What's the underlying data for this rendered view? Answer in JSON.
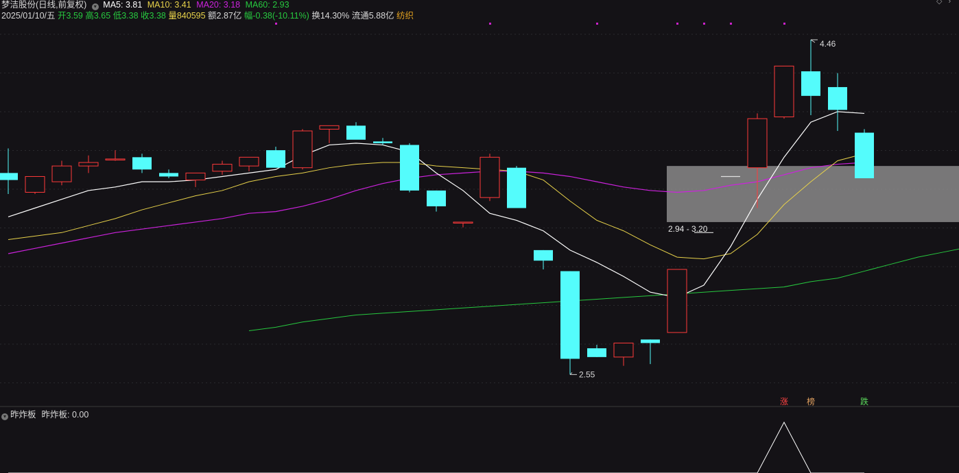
{
  "header": {
    "stock_name": "梦洁股份",
    "mode": "(日线,前复权)",
    "ma5_label": "MA5: 3.81",
    "ma10_label": "MA10: 3.41",
    "ma20_label": "MA20: 3.18",
    "ma60_label": "MA60: 2.93",
    "date": "2025/01/10/五",
    "open": "开3.59",
    "high": "高3.65",
    "low": "低3.38",
    "close": "收3.38",
    "volume": "量840595",
    "amount": "额2.87亿",
    "change": "幅-0.38(-10.11%)",
    "turnover": "换14.30%",
    "float_cap": "流通5.88亿",
    "industry": "纺织"
  },
  "sub_panel": {
    "name": "昨炸板",
    "value_label": "昨炸板: 0.00"
  },
  "colors": {
    "background": "#141216",
    "up": "#ff3a3a",
    "down": "#54fcfc",
    "ma5": "#ffffff",
    "ma10": "#e8d24a",
    "ma20": "#cc22dd",
    "ma60": "#27c93f",
    "zone": "#8a8a8a",
    "marker": "#cc22cc"
  },
  "chart_data": {
    "type": "candlestick",
    "y_range": [
      2.45,
      4.55
    ],
    "candles": [
      {
        "o": 3.7,
        "h": 3.84,
        "l": 3.58,
        "c": 3.66
      },
      {
        "o": 3.59,
        "h": 3.68,
        "l": 3.58,
        "c": 3.68
      },
      {
        "o": 3.65,
        "h": 3.77,
        "l": 3.63,
        "c": 3.74
      },
      {
        "o": 3.74,
        "h": 3.8,
        "l": 3.7,
        "c": 3.76
      },
      {
        "o": 3.78,
        "h": 3.83,
        "l": 3.77,
        "c": 3.78
      },
      {
        "o": 3.79,
        "h": 3.81,
        "l": 3.7,
        "c": 3.72
      },
      {
        "o": 3.7,
        "h": 3.72,
        "l": 3.67,
        "c": 3.68
      },
      {
        "o": 3.66,
        "h": 3.7,
        "l": 3.62,
        "c": 3.7
      },
      {
        "o": 3.71,
        "h": 3.77,
        "l": 3.69,
        "c": 3.75
      },
      {
        "o": 3.74,
        "h": 3.79,
        "l": 3.71,
        "c": 3.79
      },
      {
        "o": 3.83,
        "h": 3.85,
        "l": 3.73,
        "c": 3.73
      },
      {
        "o": 3.73,
        "h": 3.95,
        "l": 3.72,
        "c": 3.94
      },
      {
        "o": 3.95,
        "h": 3.97,
        "l": 3.87,
        "c": 3.97
      },
      {
        "o": 3.97,
        "h": 3.99,
        "l": 3.9,
        "c": 3.89
      },
      {
        "o": 3.88,
        "h": 3.9,
        "l": 3.86,
        "c": 3.87
      },
      {
        "o": 3.86,
        "h": 3.87,
        "l": 3.59,
        "c": 3.6
      },
      {
        "o": 3.6,
        "h": 3.6,
        "l": 3.48,
        "c": 3.51
      },
      {
        "o": 3.42,
        "h": 3.42,
        "l": 3.39,
        "c": 3.42
      },
      {
        "o": 3.56,
        "h": 3.81,
        "l": 3.54,
        "c": 3.79
      },
      {
        "o": 3.73,
        "h": 3.74,
        "l": 3.54,
        "c": 3.5
      },
      {
        "o": 3.26,
        "h": 3.26,
        "l": 3.15,
        "c": 3.2
      },
      {
        "o": 3.14,
        "h": 3.14,
        "l": 2.55,
        "c": 2.64
      },
      {
        "o": 2.7,
        "h": 2.72,
        "l": 2.65,
        "c": 2.65
      },
      {
        "o": 2.65,
        "h": 2.67,
        "l": 2.6,
        "c": 2.73
      },
      {
        "o": 2.75,
        "h": 2.75,
        "l": 2.61,
        "c": 2.73
      },
      {
        "o": 2.79,
        "h": 3.15,
        "l": 2.79,
        "c": 3.15
      },
      {
        "o": 3.36,
        "h": 3.36,
        "l": 3.36,
        "c": 3.36
      },
      {
        "o": 3.68,
        "h": 3.68,
        "l": 3.68,
        "c": 3.68
      },
      {
        "o": 3.73,
        "h": 4.04,
        "l": 3.5,
        "c": 4.01
      },
      {
        "o": 4.02,
        "h": 4.31,
        "l": 4.01,
        "c": 4.31
      },
      {
        "o": 4.28,
        "h": 4.46,
        "l": 4.03,
        "c": 4.14
      },
      {
        "o": 4.19,
        "h": 4.27,
        "l": 3.94,
        "c": 4.06
      },
      {
        "o": 3.93,
        "h": 3.95,
        "l": 3.68,
        "c": 3.67
      }
    ],
    "ma5": [
      3.45,
      3.5,
      3.55,
      3.6,
      3.62,
      3.65,
      3.65,
      3.66,
      3.68,
      3.7,
      3.72,
      3.8,
      3.86,
      3.87,
      3.86,
      3.82,
      3.7,
      3.6,
      3.47,
      3.43,
      3.37,
      3.26,
      3.19,
      3.11,
      3.02,
      2.99,
      3.06,
      3.28,
      3.55,
      3.79,
      3.99,
      4.05,
      4.04
    ],
    "ma10": [
      3.32,
      3.34,
      3.36,
      3.4,
      3.44,
      3.49,
      3.53,
      3.57,
      3.6,
      3.65,
      3.68,
      3.7,
      3.73,
      3.75,
      3.76,
      3.76,
      3.74,
      3.73,
      3.72,
      3.71,
      3.66,
      3.54,
      3.43,
      3.37,
      3.29,
      3.22,
      3.21,
      3.24,
      3.35,
      3.52,
      3.65,
      3.77,
      3.81
    ],
    "ma20": [
      3.24,
      3.27,
      3.3,
      3.33,
      3.36,
      3.38,
      3.4,
      3.42,
      3.44,
      3.47,
      3.48,
      3.51,
      3.55,
      3.6,
      3.64,
      3.67,
      3.69,
      3.7,
      3.71,
      3.71,
      3.7,
      3.68,
      3.65,
      3.62,
      3.6,
      3.59,
      3.6,
      3.63,
      3.65,
      3.69,
      3.73,
      3.75,
      3.76
    ],
    "ma60_start": 9,
    "ma60": [
      2.8,
      2.82,
      2.85,
      2.87,
      2.89,
      2.9,
      2.91,
      2.92,
      2.93,
      2.94,
      2.95,
      2.96,
      2.97,
      2.98,
      2.99,
      3.0,
      3.01,
      3.02,
      3.03,
      3.04,
      3.05,
      3.08,
      3.1,
      3.14,
      3.18,
      3.22,
      3.25,
      3.28
    ],
    "high_label": "4.46",
    "low_label": "2.55",
    "zone": {
      "from_index": 25,
      "top": 3.74,
      "bottom": 3.42,
      "label": "2.94 - 3.20"
    },
    "event_markers": [
      {
        "index": 29,
        "label": "涨",
        "color": "#ff4444"
      },
      {
        "index": 30,
        "label": "榜",
        "color": "#e0a060"
      },
      {
        "index": 32,
        "label": "跌",
        "color": "#5ad65a"
      }
    ],
    "top_marker_indices": [
      10,
      18,
      22,
      25,
      26,
      27,
      29
    ],
    "sub_indicator": {
      "name": "昨炸板",
      "values": [
        0,
        0,
        0,
        0,
        0,
        0,
        0,
        0,
        0,
        0,
        0,
        0,
        0,
        0,
        0,
        0,
        0,
        0,
        0,
        0,
        0,
        0,
        0,
        0,
        0,
        0,
        0,
        0,
        0,
        1,
        0,
        0,
        0
      ]
    }
  }
}
